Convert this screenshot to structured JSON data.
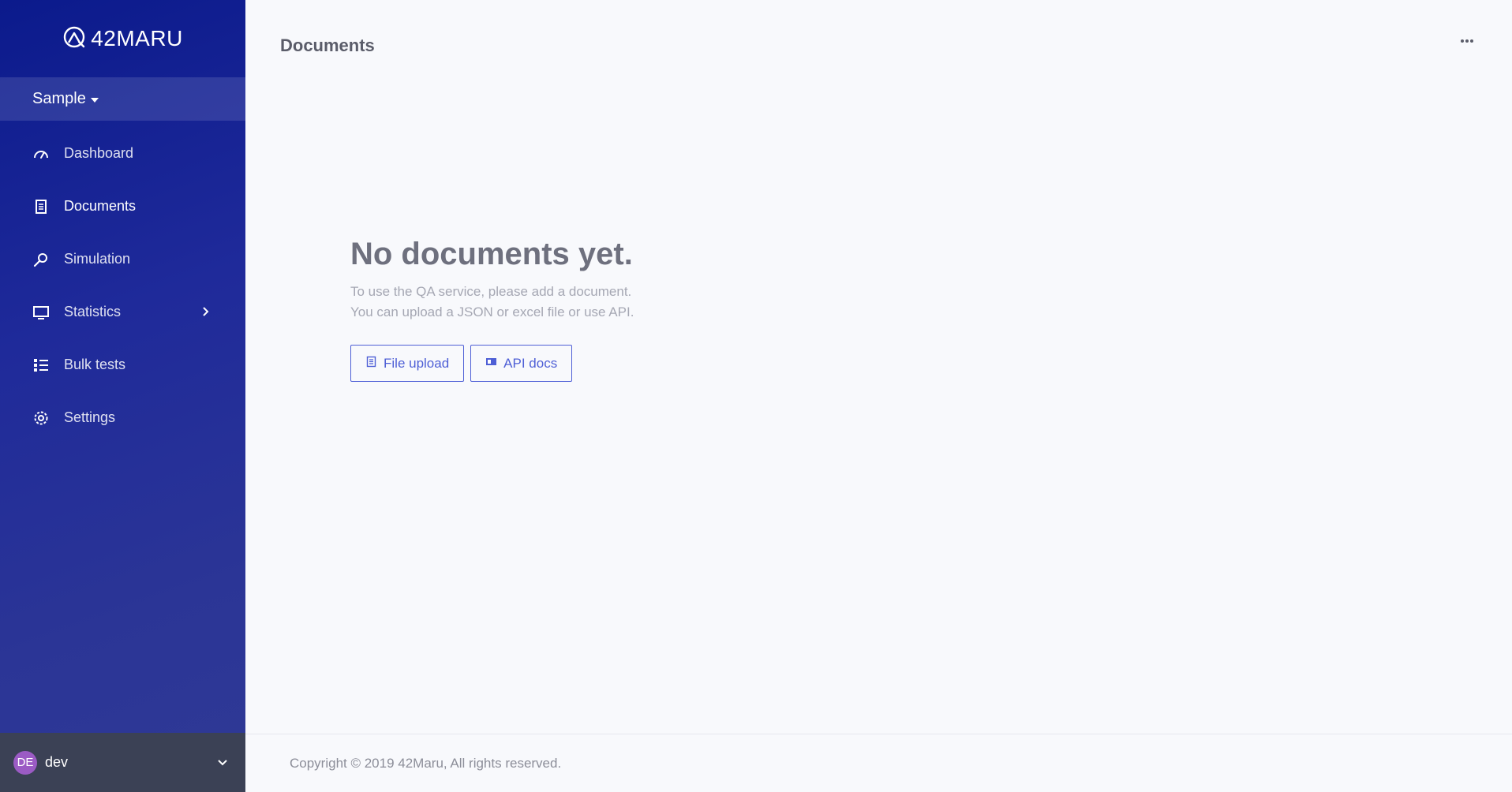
{
  "sidebar": {
    "brand": {
      "name": "42MARU",
      "icon": "logo-icon"
    },
    "project": {
      "label": "Sample"
    },
    "items": [
      {
        "label": "Dashboard",
        "icon": "gauge-icon",
        "active": false
      },
      {
        "label": "Documents",
        "icon": "document-icon",
        "active": true
      },
      {
        "label": "Simulation",
        "icon": "key-search-icon",
        "active": false
      },
      {
        "label": "Statistics",
        "icon": "monitor-icon",
        "active": false,
        "has_submenu": true
      },
      {
        "label": "Bulk tests",
        "icon": "list-icon",
        "active": false
      },
      {
        "label": "Settings",
        "icon": "gear-icon",
        "active": false
      }
    ],
    "user": {
      "initials": "DE",
      "name": "dev"
    }
  },
  "header": {
    "title": "Documents",
    "more_icon": "ellipsis-icon"
  },
  "empty_state": {
    "title": "No documents yet.",
    "line1": "To use the QA service, please add a document.",
    "line2": "You can upload a JSON or excel file or use API.",
    "file_upload_label": "File upload",
    "api_docs_label": "API docs"
  },
  "footer": {
    "copyright": "Copyright © 2019 42Maru, All rights reserved."
  },
  "colors": {
    "sidebar_top": "#0b1a8c",
    "sidebar_bottom": "#2f3995",
    "accent": "#4e5fd6",
    "user_bar": "#3b4155",
    "avatar": "#9b5bc4"
  }
}
